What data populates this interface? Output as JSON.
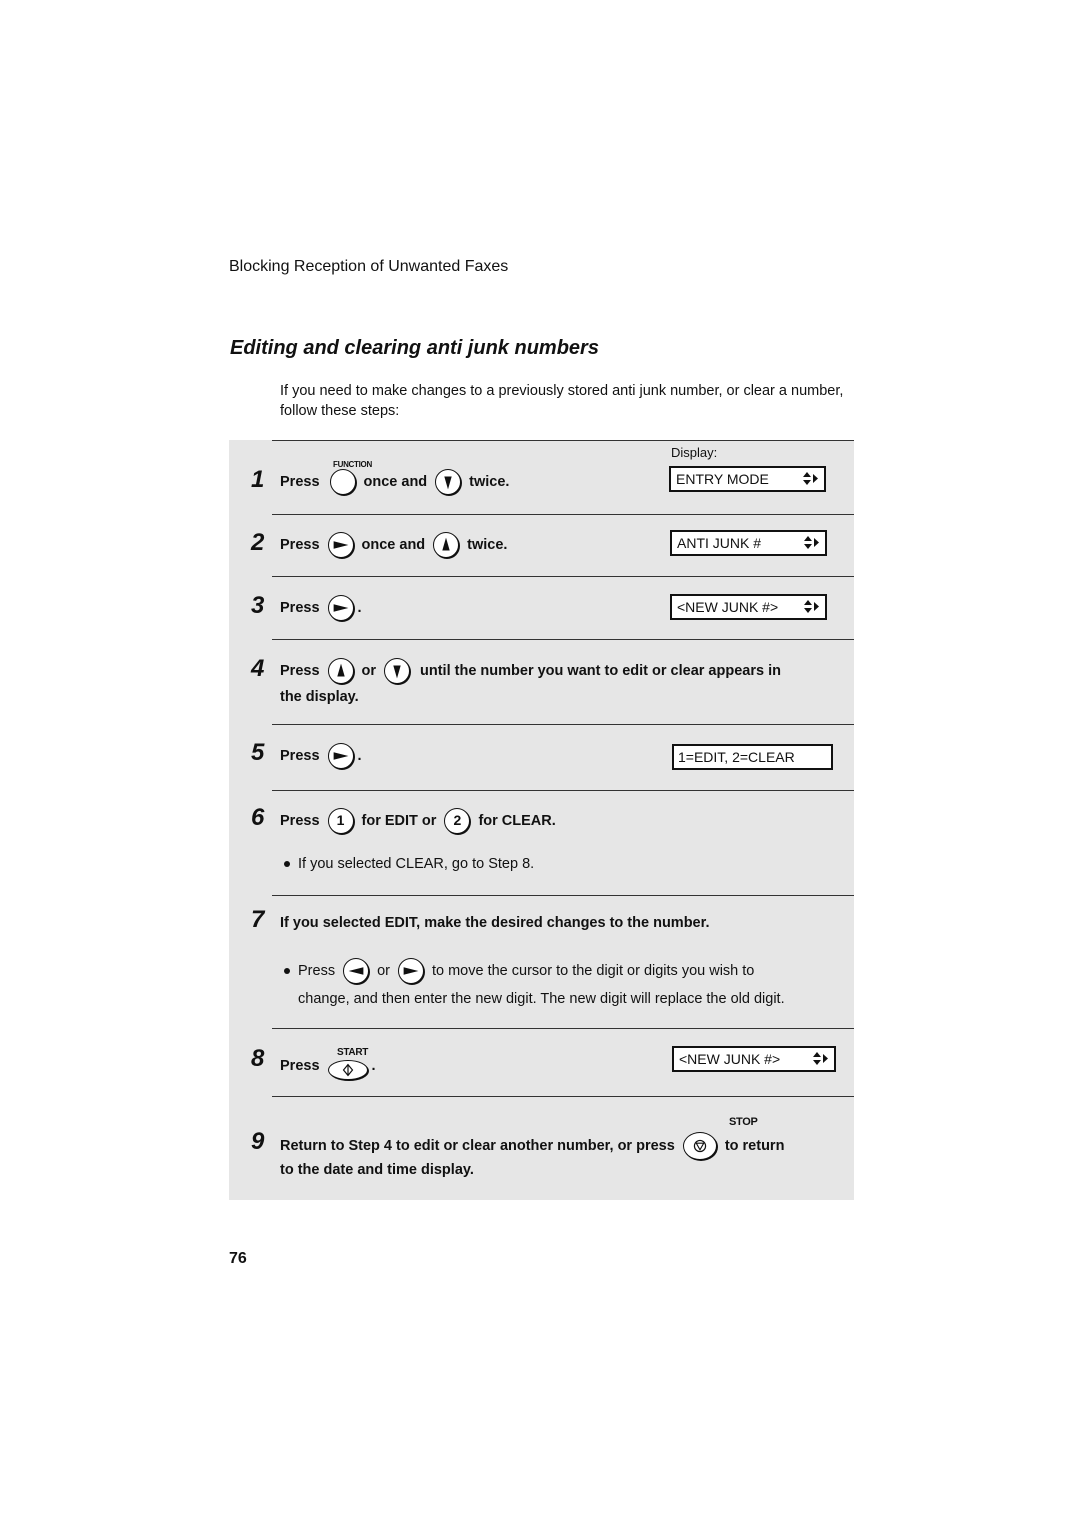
{
  "header": {
    "title": "Blocking Reception of Unwanted Faxes"
  },
  "section": {
    "title": "Editing and clearing anti junk numbers",
    "intro": "If you need to make changes to a previously stored anti junk number, or clear a number, follow these steps:"
  },
  "display_label": "Display:",
  "buttons": {
    "function": "FUNCTION",
    "start": "START",
    "stop": "STOP",
    "one": "1",
    "two": "2"
  },
  "steps": [
    {
      "num": "1",
      "press": "Press",
      "mid": "once and",
      "end": "twice.",
      "display": "ENTRY MODE"
    },
    {
      "num": "2",
      "press": "Press",
      "mid": "once and",
      "end": "twice.",
      "display": "ANTI JUNK #"
    },
    {
      "num": "3",
      "press": "Press",
      "end": ".",
      "display": "<NEW JUNK #>"
    },
    {
      "num": "4",
      "press": "Press",
      "mid": "or",
      "end": "until the number you want to edit or clear appears in",
      "cont": "the display."
    },
    {
      "num": "5",
      "press": "Press",
      "end": ".",
      "display": "1=EDIT, 2=CLEAR"
    },
    {
      "num": "6",
      "press": "Press",
      "mid": "for EDIT or",
      "end": "for CLEAR.",
      "note": "If you selected CLEAR, go to Step 8."
    },
    {
      "num": "7",
      "text": "If you selected EDIT, make the desired changes to the number.",
      "note_press": "Press",
      "note_or": "or",
      "note_end": "to move the cursor to the digit or digits you wish to",
      "note_cont": "change, and then enter the new digit. The new digit will replace the old digit."
    },
    {
      "num": "8",
      "press": "Press",
      "end": ".",
      "display": "<NEW JUNK #>"
    },
    {
      "num": "9",
      "text": "Return to Step 4 to edit or clear another number, or press",
      "end": "to return",
      "cont": "to the date and time display."
    }
  ],
  "page_number": "76"
}
